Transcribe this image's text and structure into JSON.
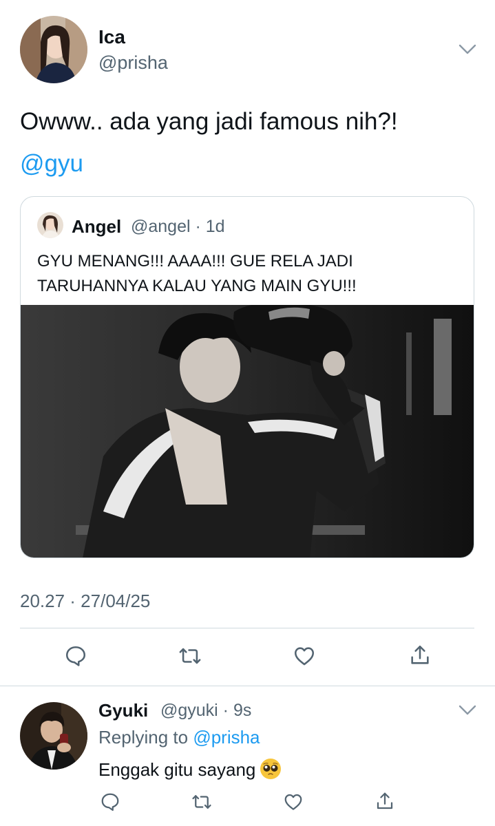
{
  "tweet": {
    "author_name": "Ica",
    "author_handle": "@prisha",
    "text": "Owww.. ada yang jadi famous nih?!",
    "mention": "@gyu",
    "timestamp": "20.27 · 27/04/25"
  },
  "quote": {
    "author_name": "Angel",
    "author_handle": "@angel · 1d",
    "text_line1": "GYU MENANG!!! AAAA!!! GUE RELA JADI",
    "text_line2": "TARUHANNYA KALAU YANG MAIN GYU!!!"
  },
  "reply": {
    "author_name": "Gyuki",
    "author_handle": "@gyuki · 9s",
    "replying_prefix": "Replying to ",
    "replying_handle": "@prisha",
    "text": "Enggak gitu sayang"
  },
  "icons": {
    "reply": "reply-icon",
    "retweet": "retweet-icon",
    "like": "heart-icon",
    "share": "share-icon",
    "more": "chevron-down-icon",
    "emoji": "pleading-face-emoji"
  },
  "colors": {
    "link": "#1d9bf0",
    "secondary_text": "#536471",
    "border": "#cfd9de"
  }
}
